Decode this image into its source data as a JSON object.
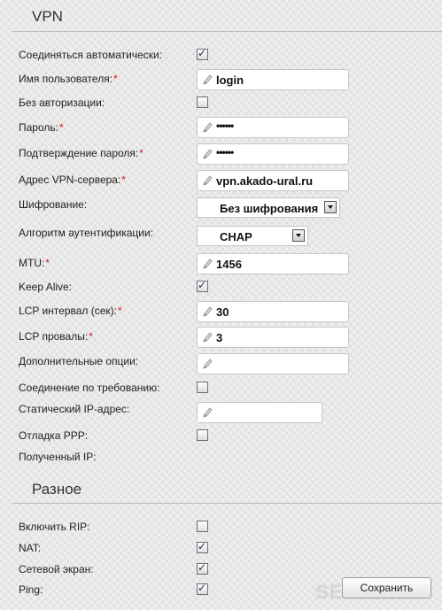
{
  "vpn": {
    "title": "VPN",
    "rows": {
      "auto_connect": {
        "label": "Соединяться автоматически:",
        "checked": true
      },
      "username": {
        "label": "Имя пользователя:",
        "required": "*",
        "value": "login"
      },
      "no_auth": {
        "label": "Без авторизации:",
        "checked": false
      },
      "password": {
        "label": "Пароль:",
        "required": "*",
        "value": "••••••"
      },
      "password_confirm": {
        "label": "Подтверждение пароля:",
        "required": "*",
        "value": "••••••"
      },
      "server": {
        "label": "Адрес VPN-сервера:",
        "required": "*",
        "value": "vpn.akado-ural.ru"
      },
      "encryption": {
        "label": "Шифрование:",
        "value": "Без шифрования"
      },
      "auth_algo": {
        "label": "Алгоритм аутентификации:",
        "value": "CHAP"
      },
      "mtu": {
        "label": "MTU:",
        "required": "*",
        "value": "1456"
      },
      "keep_alive": {
        "label": "Keep Alive:",
        "checked": true
      },
      "lcp_interval": {
        "label": "LCP интервал (сек):",
        "required": "*",
        "value": "30"
      },
      "lcp_fails": {
        "label": "LCP провалы:",
        "required": "*",
        "value": "3"
      },
      "extra_options": {
        "label": "Дополнительные опции:",
        "value": ""
      },
      "on_demand": {
        "label": "Соединение по требованию:",
        "checked": false
      },
      "static_ip": {
        "label": "Статический IP-адрес:",
        "value": ""
      },
      "ppp_debug": {
        "label": "Отладка PPP:",
        "checked": false
      },
      "received_ip": {
        "label": "Полученный IP:"
      }
    }
  },
  "misc": {
    "title": "Разное",
    "rows": {
      "rip": {
        "label": "Включить RIP:",
        "checked": false
      },
      "nat": {
        "label": "NAT:",
        "checked": true
      },
      "firewall": {
        "label": "Сетевой экран:",
        "checked": true
      },
      "ping": {
        "label": "Ping:",
        "checked": true
      }
    }
  },
  "save_label": "Сохранить",
  "watermark_text": "SETTINGS",
  "icons": {
    "field_icon": "pencil-icon",
    "dropdown_icon": "chevron-down-icon"
  }
}
